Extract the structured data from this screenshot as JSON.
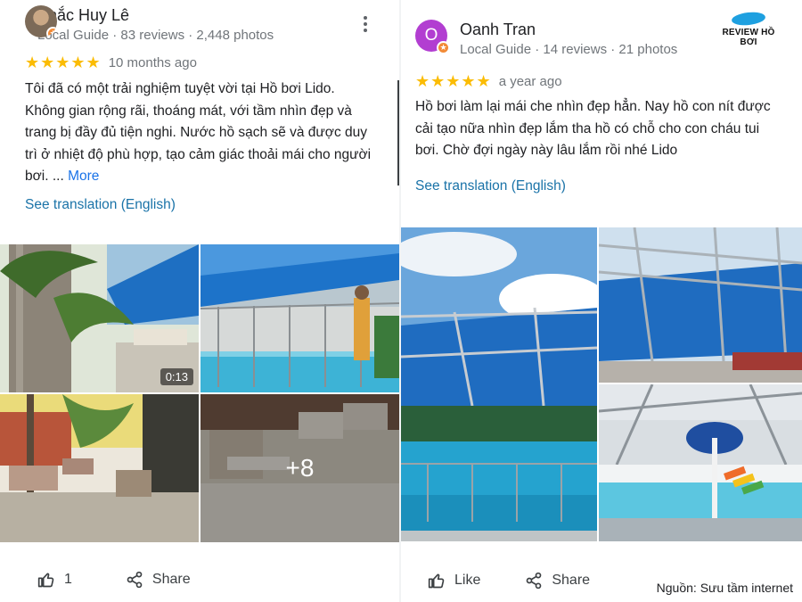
{
  "brand": {
    "name": "REVIEW HỒ BƠI",
    "color": "#1ea0e0"
  },
  "source_note": "Nguồn: Sưu tầm internet",
  "reviews": [
    {
      "name": "Khắc Huy Lê",
      "meta": "Local Guide · 83 reviews · 2,448 photos",
      "avatar_icon": "person-photo",
      "badge_icon": "local-guide-star",
      "stars": "★★★★★",
      "rating": 5,
      "age": "10 months ago",
      "text": "Tôi đã có một trải nghiệm tuyệt vời tại Hồ bơi Lido. Không gian rộng rãi, thoáng mát, với tầm nhìn đẹp và trang bị đầy đủ tiện nghi. Nước hồ sạch sẽ và được duy trì ở nhiệt độ phù hợp, tạo cảm giác thoải mái cho người bơi. ...",
      "more_label": "More",
      "translate_label": "See translation (English)",
      "photos": [
        {
          "label": "Palm trees and shade awning"
        },
        {
          "label": "Pool with blue retractable roof"
        },
        {
          "label": "Courtyard with planters and benches"
        },
        {
          "label": "Tiled pool deck with benches"
        }
      ],
      "video_duration": "0:13",
      "more_photos": "+8",
      "like_label": "1",
      "share_label": "Share"
    },
    {
      "name": "Oanh Tran",
      "meta": "Local Guide · 14 reviews · 21 photos",
      "avatar_letter": "O",
      "avatar_color": "#b23ed1",
      "badge_icon": "local-guide-star",
      "stars": "★★★★★",
      "rating": 5,
      "age": "a year ago",
      "text": "Hồ bơi làm lại mái che nhìn đẹp hẳn. Nay hồ con nít được cải tạo nữa nhìn đẹp lắm tha hồ có chỗ cho con cháu tui bơi. Chờ đợi ngày này lâu lắm rồi nhé Lido",
      "translate_label": "See translation (English)",
      "photos": [
        {
          "label": "Pool under blue awning with sky"
        },
        {
          "label": "Steel roof frame with blue fabric"
        },
        {
          "label": "Kids pool with mushroom fountain and slides"
        }
      ],
      "like_label": "Like",
      "share_label": "Share"
    }
  ]
}
